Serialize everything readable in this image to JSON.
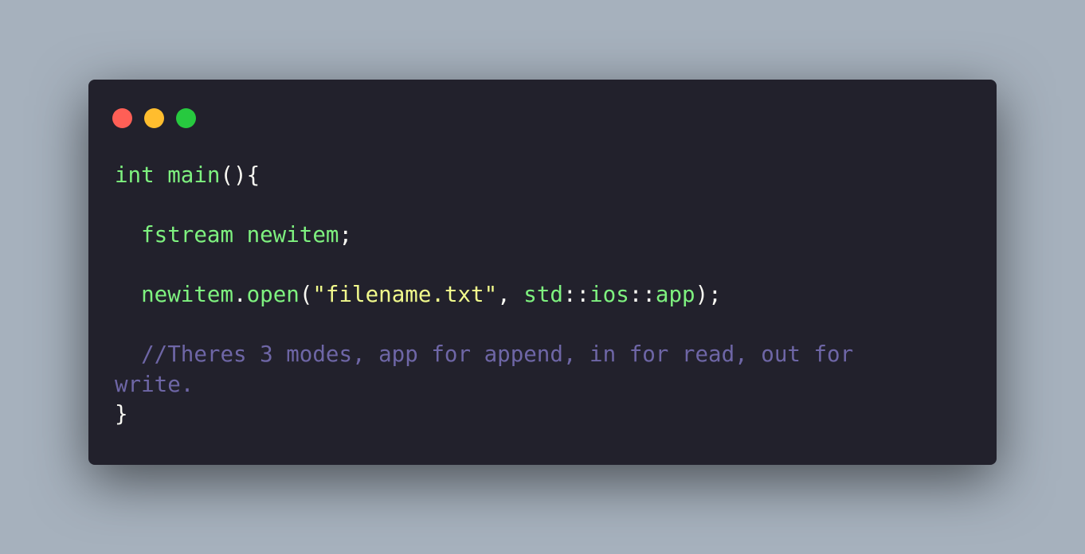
{
  "window": {
    "background": "#22212c",
    "controls": [
      {
        "name": "close",
        "color": "#ff5f56"
      },
      {
        "name": "minimize",
        "color": "#ffbd2e"
      },
      {
        "name": "maximize",
        "color": "#27c93f"
      }
    ]
  },
  "code": {
    "language": "C++",
    "lines": [
      {
        "tokens": [
          {
            "text": "int main",
            "kind": "fn"
          },
          {
            "text": "(){",
            "kind": "punc"
          }
        ]
      },
      {
        "tokens": []
      },
      {
        "tokens": [
          {
            "text": "  fstream newitem",
            "kind": "fn"
          },
          {
            "text": ";",
            "kind": "punc"
          }
        ]
      },
      {
        "tokens": []
      },
      {
        "tokens": [
          {
            "text": "  newitem",
            "kind": "fn"
          },
          {
            "text": ".",
            "kind": "punc"
          },
          {
            "text": "open",
            "kind": "fn"
          },
          {
            "text": "(",
            "kind": "punc"
          },
          {
            "text": "\"filename.txt\"",
            "kind": "str"
          },
          {
            "text": ", ",
            "kind": "punc"
          },
          {
            "text": "std",
            "kind": "fn"
          },
          {
            "text": "::",
            "kind": "punc"
          },
          {
            "text": "ios",
            "kind": "fn"
          },
          {
            "text": "::",
            "kind": "punc"
          },
          {
            "text": "app",
            "kind": "fn"
          },
          {
            "text": ");",
            "kind": "punc"
          }
        ]
      },
      {
        "tokens": []
      },
      {
        "tokens": [
          {
            "text": "  //Theres 3 modes, app for append, in for read, out for",
            "kind": "comment"
          }
        ]
      },
      {
        "tokens": [
          {
            "text": "write.",
            "kind": "comment"
          }
        ]
      },
      {
        "tokens": [
          {
            "text": "}",
            "kind": "punc"
          }
        ]
      }
    ]
  }
}
